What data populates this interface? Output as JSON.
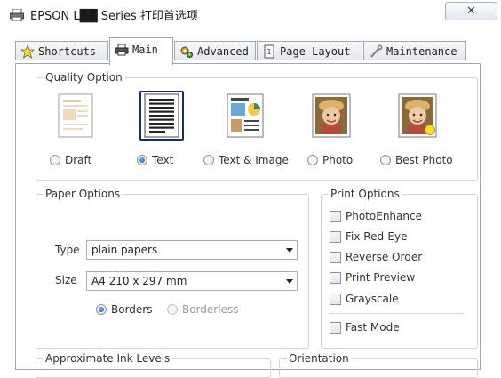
{
  "window": {
    "title": "EPSON L██ Series 打印首选项",
    "close_label": "✕"
  },
  "tabs": [
    {
      "label": "Shortcuts",
      "icon": "star-icon"
    },
    {
      "label": "Main",
      "icon": "printer-icon",
      "active": true
    },
    {
      "label": "Advanced",
      "icon": "gears-icon"
    },
    {
      "label": "Page Layout",
      "icon": "page-icon"
    },
    {
      "label": "Maintenance",
      "icon": "wrench-icon"
    }
  ],
  "quality": {
    "group_label": "Quality Option",
    "options": [
      {
        "label": "Draft",
        "selected": false
      },
      {
        "label": "Text",
        "selected": true
      },
      {
        "label": "Text & Image",
        "selected": false
      },
      {
        "label": "Photo",
        "selected": false
      },
      {
        "label": "Best Photo",
        "selected": false
      }
    ]
  },
  "paper": {
    "group_label": "Paper Options",
    "type_label": "Type",
    "type_value": "plain papers",
    "size_label": "Size",
    "size_value": "A4 210 x 297 mm",
    "borders_label": "Borders",
    "borderless_label": "Borderless"
  },
  "print_options": {
    "group_label": "Print Options",
    "items": [
      "PhotoEnhance",
      "Fix Red-Eye",
      "Reverse Order",
      "Print Preview",
      "Grayscale"
    ],
    "fast_mode": "Fast Mode"
  },
  "bottom": {
    "ink_label": "Approximate Ink Levels",
    "orientation_label": "Orientation"
  },
  "colors": {
    "selection_border": "#1b2a6b",
    "radio_selected": "#1d4f9a"
  }
}
